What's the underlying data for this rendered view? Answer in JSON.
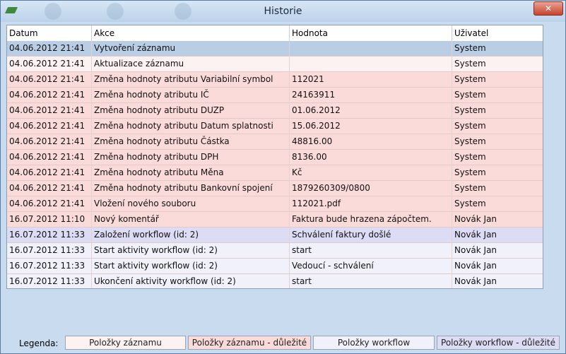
{
  "window": {
    "title": "Historie",
    "close_label": "✕"
  },
  "table": {
    "columns": [
      "Datum",
      "Akce",
      "Hodnota",
      "Uživatel"
    ],
    "rows": [
      {
        "datum": "04.06.2012 21:41",
        "akce": "Vytvoření záznamu",
        "hodnota": "",
        "uzivatel": "System",
        "type": "selected"
      },
      {
        "datum": "04.06.2012 21:41",
        "akce": "Aktualizace záznamu",
        "hodnota": "",
        "uzivatel": "System",
        "type": "record"
      },
      {
        "datum": "04.06.2012 21:41",
        "akce": "Změna hodnoty atributu Variabilní symbol",
        "hodnota": "112021",
        "uzivatel": "System",
        "type": "record_important"
      },
      {
        "datum": "04.06.2012 21:41",
        "akce": "Změna hodnoty atributu IČ",
        "hodnota": "24163911",
        "uzivatel": "System",
        "type": "record_important"
      },
      {
        "datum": "04.06.2012 21:41",
        "akce": "Změna hodnoty atributu DUZP",
        "hodnota": "01.06.2012",
        "uzivatel": "System",
        "type": "record_important"
      },
      {
        "datum": "04.06.2012 21:41",
        "akce": "Změna hodnoty atributu Datum splatnosti",
        "hodnota": "15.06.2012",
        "uzivatel": "System",
        "type": "record_important"
      },
      {
        "datum": "04.06.2012 21:41",
        "akce": "Změna hodnoty atributu Částka",
        "hodnota": "48816.00",
        "uzivatel": "System",
        "type": "record_important"
      },
      {
        "datum": "04.06.2012 21:41",
        "akce": "Změna hodnoty atributu DPH",
        "hodnota": "8136.00",
        "uzivatel": "System",
        "type": "record_important"
      },
      {
        "datum": "04.06.2012 21:41",
        "akce": "Změna hodnoty atributu Měna",
        "hodnota": "Kč",
        "uzivatel": "System",
        "type": "record_important"
      },
      {
        "datum": "04.06.2012 21:41",
        "akce": "Změna hodnoty atributu Bankovní spojení",
        "hodnota": "1879260309/0800",
        "uzivatel": "System",
        "type": "record_important"
      },
      {
        "datum": "04.06.2012 21:41",
        "akce": "Vložení nového souboru",
        "hodnota": "112021.pdf",
        "uzivatel": "System",
        "type": "record_important"
      },
      {
        "datum": "16.07.2012 11:10",
        "akce": "Nový komentář",
        "hodnota": "Faktura bude hrazena zápočtem.",
        "uzivatel": "Novák Jan",
        "type": "record_important"
      },
      {
        "datum": "16.07.2012 11:33",
        "akce": "Založení workflow (id: 2)",
        "hodnota": "Schválení faktury došlé",
        "uzivatel": "Novák Jan",
        "type": "workflow_important"
      },
      {
        "datum": "16.07.2012 11:33",
        "akce": "Start aktivity workflow  (id: 2)",
        "hodnota": "start",
        "uzivatel": "Novák Jan",
        "type": "workflow"
      },
      {
        "datum": "16.07.2012 11:33",
        "akce": "Start aktivity workflow  (id: 2)",
        "hodnota": "Vedoucí - schválení",
        "uzivatel": "Novák Jan",
        "type": "workflow"
      },
      {
        "datum": "16.07.2012 11:33",
        "akce": "Ukončení aktivity workflow  (id: 2)",
        "hodnota": "start",
        "uzivatel": "Novák Jan",
        "type": "workflow"
      }
    ]
  },
  "legend": {
    "label": "Legenda:",
    "items": [
      {
        "label": "Položky záznamu",
        "type": "record"
      },
      {
        "label": "Položky záznamu - důležité",
        "type": "record_important"
      },
      {
        "label": "Položky workflow",
        "type": "workflow"
      },
      {
        "label": "Položky workflow - důležité",
        "type": "workflow_important"
      }
    ]
  },
  "colors": {
    "selected": "#b9cde5",
    "record": "#fdf2f2",
    "record_important": "#fbdada",
    "workflow": "#f1f1fb",
    "workflow_important": "#dcdcf5"
  }
}
